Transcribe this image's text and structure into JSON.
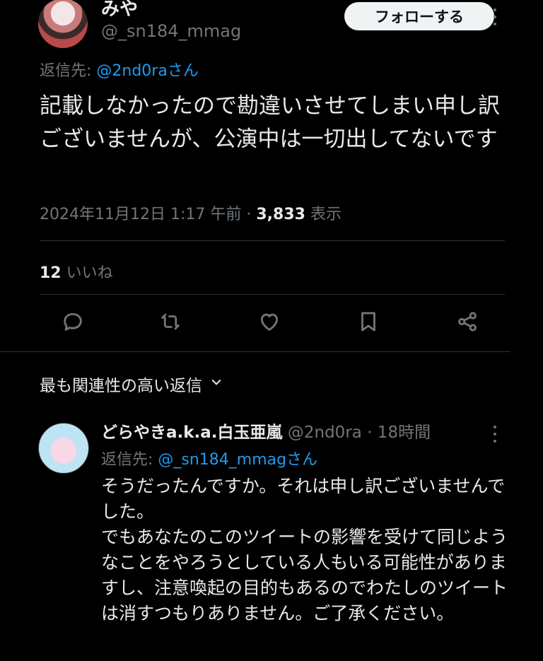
{
  "tweet": {
    "author_name": "みや",
    "author_handle": "@_sn184_mmag",
    "follow_label": "フォローする",
    "reply_to_prefix": "返信先: ",
    "reply_to_mention": "@2nd0raさん",
    "text": "記載しなかったので勘違いさせてしまい申し訳ございませんが、公演中は一切出してないです",
    "timestamp": "2024年11月12日 1:17 午前 · ",
    "views_count": "3,833",
    "views_label": " 表示",
    "likes_count": "12",
    "likes_label": " いいね"
  },
  "actions": {
    "icons": [
      "reply-icon",
      "retweet-icon",
      "like-icon",
      "bookmark-icon",
      "share-icon"
    ]
  },
  "replies_section": {
    "sort_label": "最も関連性の高い返信"
  },
  "reply": {
    "author_name": "どらやきa.k.a.白玉亜嵐",
    "author_handle": "@2nd0ra",
    "time": " · 18時間",
    "reply_to_prefix": "返信先: ",
    "reply_to_mention": "@_sn184_mmagさん",
    "text_line1": "そうだったんですか。それは申し訳ございませんでした。",
    "text_line2": "でもあなたのこのツイートの影響を受けて同じようなことをやろうとしている人もいる可能性がありますし、注意喚起の目的もあるのでわたしのツイートは消すつもりありません。ご了承ください。"
  },
  "colors": {
    "background": "#000000",
    "text": "#e7e9ea",
    "muted": "#71767b",
    "link": "#1d9bf0",
    "divider": "#2f3336"
  }
}
